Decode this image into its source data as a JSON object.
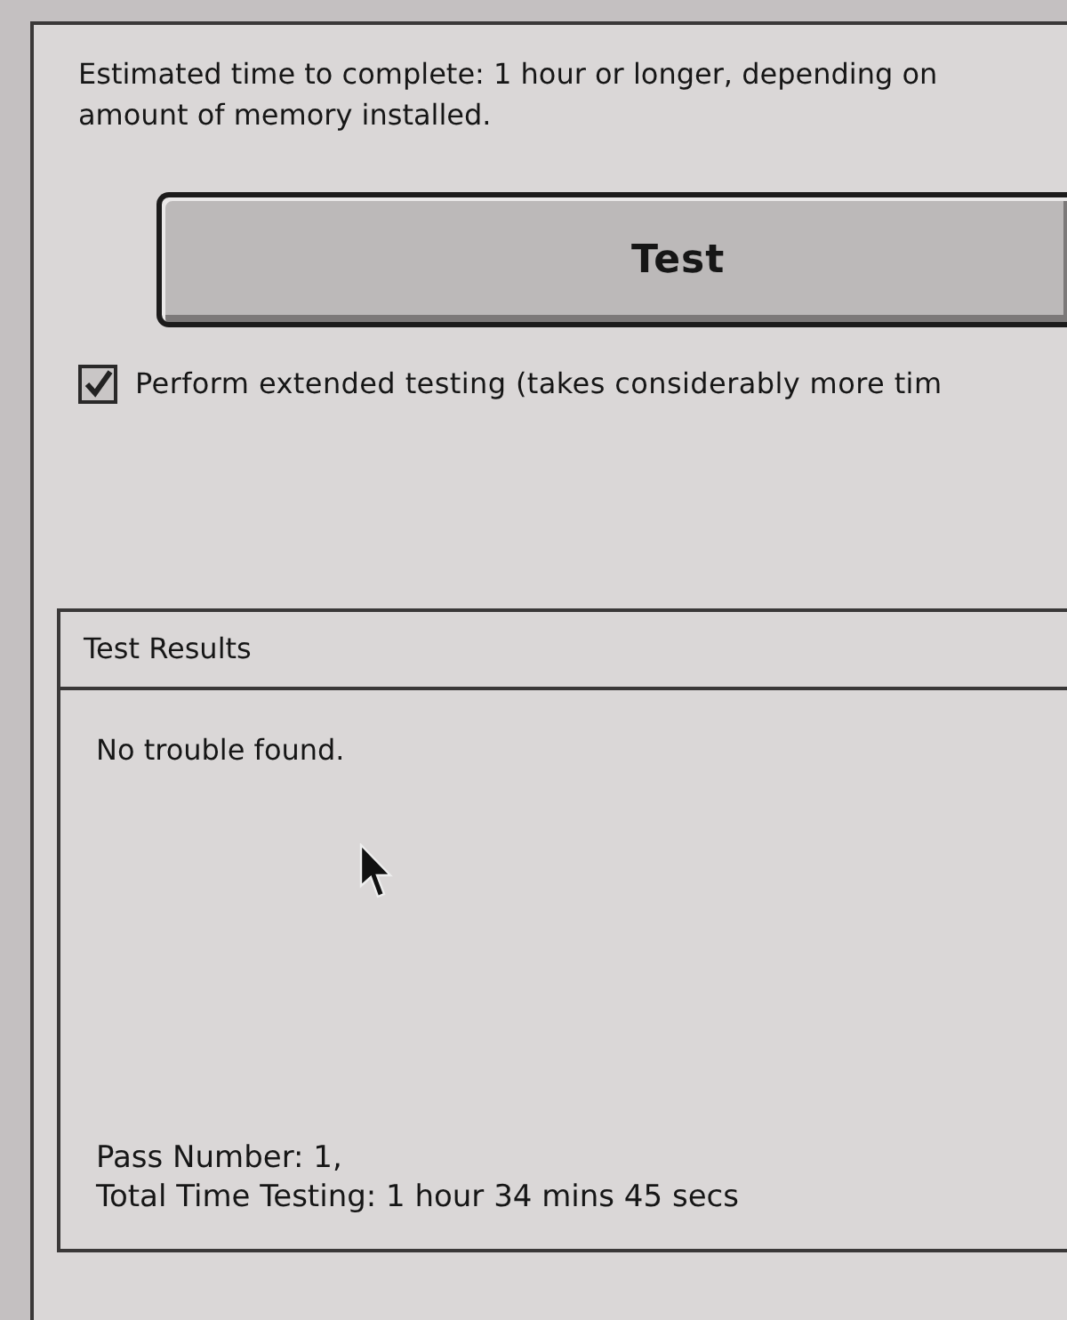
{
  "info": {
    "lines": [
      "Estimated time to complete: 1 hour or longer, depending on",
      "amount of memory installed."
    ]
  },
  "test_button": {
    "label": "Test"
  },
  "extended_testing": {
    "label": "Perform extended testing (takes considerably more tim",
    "checked": true
  },
  "results": {
    "title": "Test Results",
    "message": "No trouble found.",
    "summary": [
      "Pass Number: 1,",
      "Total Time Testing: 1 hour 34 mins 45 secs"
    ]
  }
}
